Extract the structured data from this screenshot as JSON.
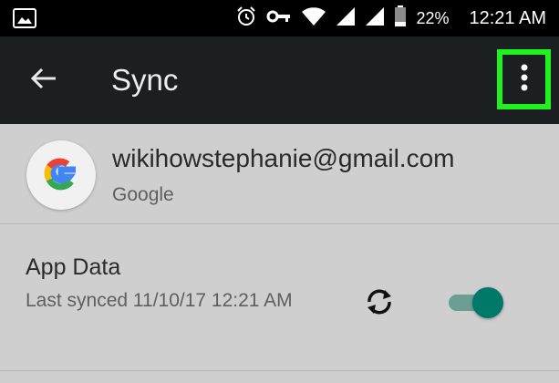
{
  "status_bar": {
    "left_icon": "image-icon",
    "icons": [
      "alarm-icon",
      "vpn-key-icon",
      "wifi-icon",
      "signal-icon",
      "signal-icon",
      "battery-icon"
    ],
    "battery": "22%",
    "time": "12:21 AM"
  },
  "app_bar": {
    "title": "Sync",
    "back_icon": "arrow-left-icon",
    "overflow_icon": "more-vert-icon",
    "highlight_color": "#1ff21f"
  },
  "account": {
    "email": "wikihowstephanie@gmail.com",
    "type": "Google",
    "avatar_icon": "google-g-icon"
  },
  "sync_items": [
    {
      "title": "App Data",
      "subtitle": "Last synced 11/10/17 12:21 AM",
      "sync_icon": "sync-icon",
      "toggle_on": true,
      "toggle_color": "#00796b"
    }
  ]
}
